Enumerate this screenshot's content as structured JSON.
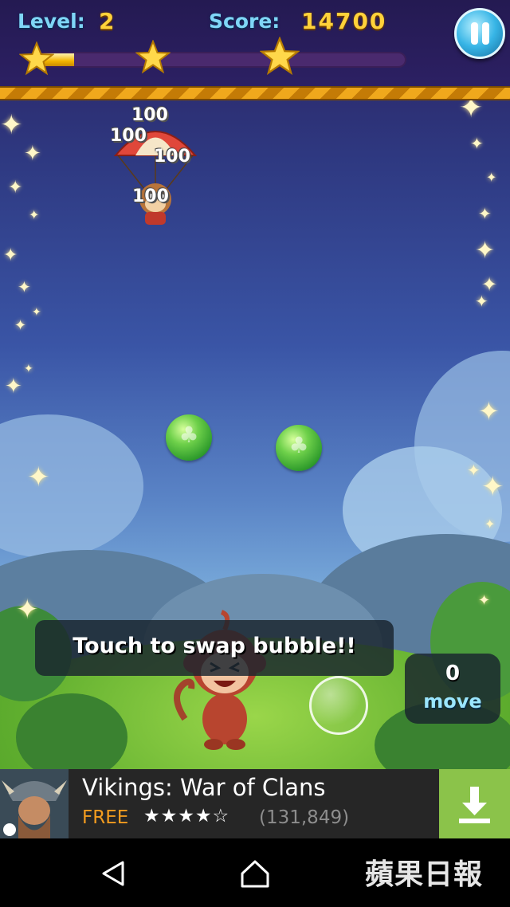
{
  "hud": {
    "level_label": "Level:",
    "level_value": "2",
    "score_label": "Score:",
    "score_value": "14700",
    "progress_fraction": 0.1
  },
  "score_popups": [
    "100",
    "100",
    "100",
    "100"
  ],
  "hint": "Touch to swap bubble!!",
  "moves": {
    "count": "0",
    "label": "move"
  },
  "ad": {
    "title": "Vikings: War of Clans",
    "price": "FREE",
    "stars": "★★★★☆",
    "reviews": "(131,849)"
  },
  "watermark": "蘋果日報",
  "colors": {
    "score_gold": "#ffd23a",
    "label_cyan": "#7fd6f7",
    "bubble_green": "#6ed04a",
    "ad_accent": "#8bc34a",
    "ad_free": "#f39c1f"
  },
  "icons": [
    "pause-icon",
    "star-icon",
    "clover-icon",
    "download-icon",
    "back-icon",
    "home-icon"
  ]
}
